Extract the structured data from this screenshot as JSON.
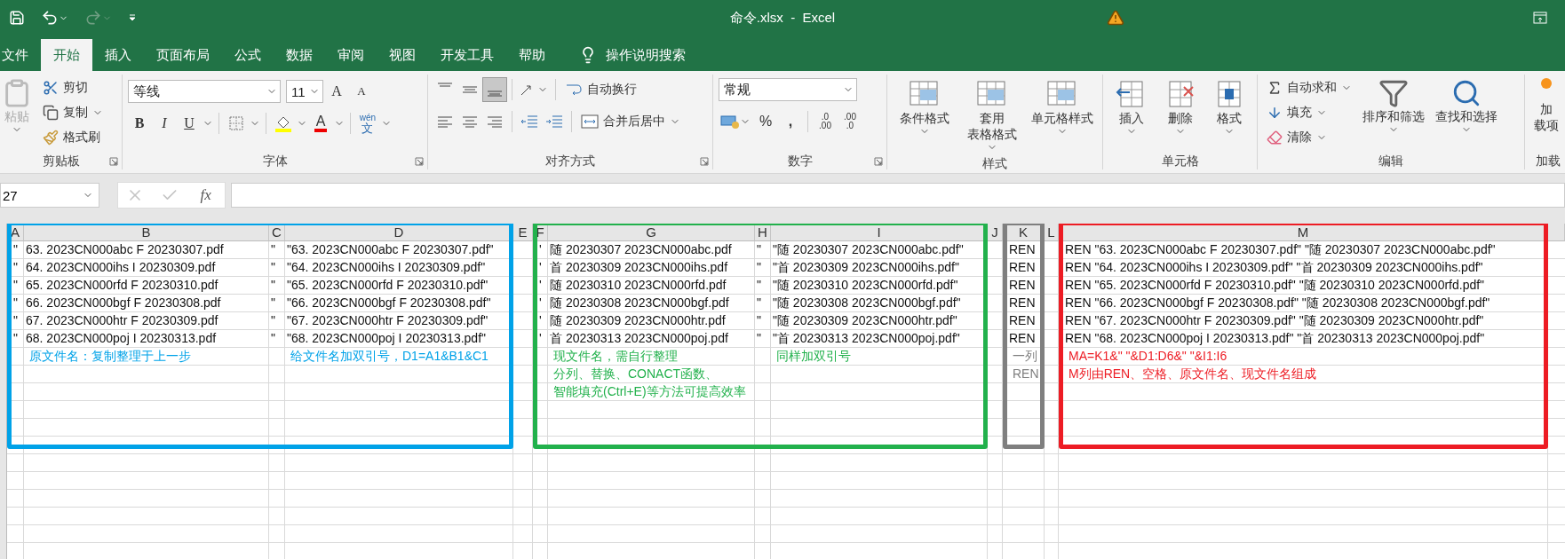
{
  "quick_access": [
    {
      "kind": "save",
      "disabled": false
    },
    {
      "kind": "undo",
      "disabled": false
    },
    {
      "kind": "redo",
      "disabled": true
    },
    {
      "kind": "customize",
      "disabled": false
    }
  ],
  "title_bar": {
    "title": "命令.xlsx  -  Excel"
  },
  "menu_tabs": [
    {
      "label": "文件",
      "selected": false
    },
    {
      "label": "开始",
      "selected": true
    },
    {
      "label": "插入",
      "selected": false
    },
    {
      "label": "页面布局",
      "selected": false
    },
    {
      "label": "公式",
      "selected": false
    },
    {
      "label": "数据",
      "selected": false
    },
    {
      "label": "审阅",
      "selected": false
    },
    {
      "label": "视图",
      "selected": false
    },
    {
      "label": "开发工具",
      "selected": false
    },
    {
      "label": "帮助",
      "selected": false
    }
  ],
  "tell_me": "操作说明搜索",
  "ribbon": [
    {
      "kind": "clipboard",
      "label": "剪贴板",
      "paste": {
        "label": "粘贴",
        "disabled": true
      },
      "items": [
        "剪切",
        "复制",
        "格式刷"
      ]
    },
    {
      "kind": "font",
      "label": "字体",
      "font": "等线",
      "size": "11",
      "grow": "A",
      "shrink": "A",
      "styles": [
        "B",
        "I",
        "U"
      ],
      "color_letter": "A",
      "phonetic": [
        "wén",
        "文"
      ]
    },
    {
      "kind": "alignment",
      "label": "对齐方式",
      "wrap": "自动换行",
      "merge": "合并后居中"
    },
    {
      "kind": "number",
      "label": "数字",
      "format": "常规",
      "percent": "%",
      "comma": ",",
      "decimals": [
        [
          ".0",
          ".00"
        ],
        [
          ".00",
          ".0"
        ]
      ]
    },
    {
      "kind": "styles",
      "label": "样式",
      "buttons": [
        {
          "lines": [
            "条件格式"
          ]
        },
        {
          "lines": [
            "套用",
            "表格格式"
          ]
        },
        {
          "lines": [
            "单元格样式"
          ]
        }
      ]
    },
    {
      "kind": "cells",
      "label": "单元格",
      "buttons": [
        "插入",
        "删除",
        "格式"
      ]
    },
    {
      "kind": "editing",
      "label": "编辑",
      "small": [
        "自动求和",
        "填充",
        "清除"
      ],
      "buttons": [
        "排序和筛选",
        "查找和选择"
      ]
    },
    {
      "kind": "addins",
      "label": "加载",
      "button": [
        "加",
        "载项"
      ]
    }
  ],
  "formula_bar": {
    "name_box": "27",
    "function_label": "fx",
    "cancel_disabled": true,
    "enter_disabled": true
  },
  "sheet": {
    "groups": [
      {
        "color": "#00a2e8",
        "columns": [
          {
            "label": "A",
            "cells": [
              "\"",
              "\"",
              "\"",
              "\"",
              "\"",
              "\""
            ]
          },
          {
            "label": "B",
            "cells": [
              "63. 2023CN000abc F 20230307.pdf",
              "64. 2023CN000ihs I 20230309.pdf",
              "65. 2023CN000rfd F 20230310.pdf",
              "66. 2023CN000bgf F 20230308.pdf",
              "67. 2023CN000htr F 20230309.pdf",
              "68. 2023CN000poj I 20230313.pdf"
            ],
            "notes": [
              "原文件名：复制整理于上一步"
            ]
          },
          {
            "label": "C",
            "cells": [
              "\"",
              "\"",
              "\"",
              "\"",
              "\"",
              "\""
            ]
          },
          {
            "label": "D",
            "cells": [
              "\"63. 2023CN000abc F 20230307.pdf\"",
              "\"64. 2023CN000ihs I 20230309.pdf\"",
              "\"65. 2023CN000rfd F 20230310.pdf\"",
              "\"66. 2023CN000bgf F 20230308.pdf\"",
              "\"67. 2023CN000htr F 20230309.pdf\"",
              "\"68. 2023CN000poj I 20230313.pdf\""
            ],
            "notes": [
              "给文件名加双引号，D1=A1&B1&C1"
            ]
          }
        ]
      },
      {
        "columns": [
          {
            "label": "E"
          }
        ]
      },
      {
        "color": "#22b14c",
        "columns": [
          {
            "label": "F",
            "cells": [
              "'",
              "'",
              "'",
              "'",
              "'",
              "'"
            ]
          },
          {
            "label": "G",
            "cells": [
              "随 20230307 2023CN000abc.pdf",
              "首 20230309 2023CN000ihs.pdf",
              "随 20230310 2023CN000rfd.pdf",
              "随 20230308 2023CN000bgf.pdf",
              "随 20230309 2023CN000htr.pdf",
              "首 20230313 2023CN000poj.pdf"
            ],
            "notes": [
              "现文件名，需自行整理",
              "分列、替换、CONACT函数、",
              "智能填充(Ctrl+E)等方法可提高效率"
            ]
          },
          {
            "label": "H",
            "cells": [
              "\"",
              "\"",
              "\"",
              "\"",
              "\"",
              "\""
            ]
          },
          {
            "label": "I",
            "cells": [
              "\"随 20230307 2023CN000abc.pdf\"",
              "\"首 20230309 2023CN000ihs.pdf\"",
              "\"随 20230310 2023CN000rfd.pdf\"",
              "\"随 20230308 2023CN000bgf.pdf\"",
              "\"随 20230309 2023CN000htr.pdf\"",
              "\"首 20230313 2023CN000poj.pdf\""
            ],
            "notes": [
              "同样加双引号"
            ]
          }
        ]
      },
      {
        "columns": [
          {
            "label": "J"
          }
        ]
      },
      {
        "color": "#7f7f7f",
        "columns": [
          {
            "label": "K",
            "cells": [
              "REN",
              "REN",
              "REN",
              "REN",
              "REN",
              "REN"
            ],
            "notes": [
              "一列",
              "REN"
            ]
          }
        ]
      },
      {
        "columns": [
          {
            "label": "L"
          }
        ]
      },
      {
        "color": "#ed1c24",
        "columns": [
          {
            "label": "M",
            "cells": [
              "REN \"63. 2023CN000abc F 20230307.pdf\" \"随 20230307 2023CN000abc.pdf\"",
              "REN \"64. 2023CN000ihs I 20230309.pdf\" \"首 20230309 2023CN000ihs.pdf\"",
              "REN \"65. 2023CN000rfd F 20230310.pdf\" \"随 20230310 2023CN000rfd.pdf\"",
              "REN \"66. 2023CN000bgf F 20230308.pdf\" \"随 20230308 2023CN000bgf.pdf\"",
              "REN \"67. 2023CN000htr F 20230309.pdf\" \"随 20230309 2023CN000htr.pdf\"",
              "REN \"68. 2023CN000poj I 20230313.pdf\" \"首 20230313 2023CN000poj.pdf\""
            ],
            "notes": [
              "MA=K1&\" \"&D1:D6&\" \"&I1:I6",
              "M列由REN、空格、原文件名、现文件名组成"
            ]
          }
        ]
      }
    ]
  }
}
